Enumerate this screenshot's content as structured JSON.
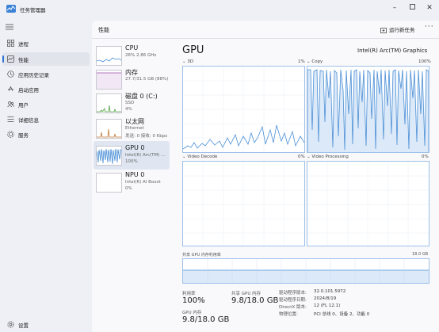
{
  "window": {
    "title": "任务管理器"
  },
  "sidebar": {
    "items": [
      {
        "label": "进程",
        "icon": "grid-icon"
      },
      {
        "label": "性能",
        "icon": "performance-icon",
        "active": true
      },
      {
        "label": "应用历史记录",
        "icon": "history-icon"
      },
      {
        "label": "启动应用",
        "icon": "startup-icon"
      },
      {
        "label": "用户",
        "icon": "users-icon"
      },
      {
        "label": "详细信息",
        "icon": "details-icon"
      },
      {
        "label": "服务",
        "icon": "services-icon"
      }
    ],
    "settings_label": "设置"
  },
  "header": {
    "title": "性能",
    "run_task_label": "运行新任务",
    "more_label": "···"
  },
  "devices": [
    {
      "name": "CPU",
      "lines": [
        "26% 2.86 GHz"
      ]
    },
    {
      "name": "内存",
      "lines": [
        "27.7/31.5 GB (88%)"
      ]
    },
    {
      "name": "磁盘 0 (C:)",
      "lines": [
        "SSD",
        "4%"
      ]
    },
    {
      "name": "以太网",
      "lines": [
        "Ethernet",
        "发送: 0 接收: 0 Kbps"
      ]
    },
    {
      "name": "GPU 0",
      "lines": [
        "Intel(R) Arc(TM) ...",
        "100%"
      ],
      "active": true
    },
    {
      "name": "NPU 0",
      "lines": [
        "Intel(R) AI Boost",
        "0%"
      ]
    }
  ],
  "detail": {
    "title": "GPU",
    "model": "Intel(R) Arc(TM) Graphics",
    "graphs": [
      {
        "label": "3D",
        "value": "1%"
      },
      {
        "label": "Copy",
        "value": "100%"
      },
      {
        "label": "Video Decode",
        "value": "0%"
      },
      {
        "label": "Video Processing",
        "value": "0%"
      }
    ],
    "shared_memory": {
      "label": "共享 GPU 内存利用率",
      "max": "18.0 GB"
    },
    "stats": [
      {
        "label": "利用率",
        "value": "100%"
      },
      {
        "label": "共享 GPU 内存",
        "value": "9.8/18.0 GB"
      },
      {
        "label": "GPU 内存",
        "value": "9.8/18.0 GB"
      }
    ],
    "info": [
      {
        "label": "驱动程序版本:",
        "value": "32.0.101.5972"
      },
      {
        "label": "驱动程序日期:",
        "value": "2024/8/19"
      },
      {
        "label": "DirectX 版本:",
        "value": "12 (FL 12.1)"
      },
      {
        "label": "物理位置:",
        "value": "PCI 总线 0、设备 2、功能 0"
      }
    ]
  },
  "colors": {
    "accent": "#2f6fd0",
    "gpu_line": "#4b8fd6",
    "gpu_fill": "#dbe9f8"
  }
}
